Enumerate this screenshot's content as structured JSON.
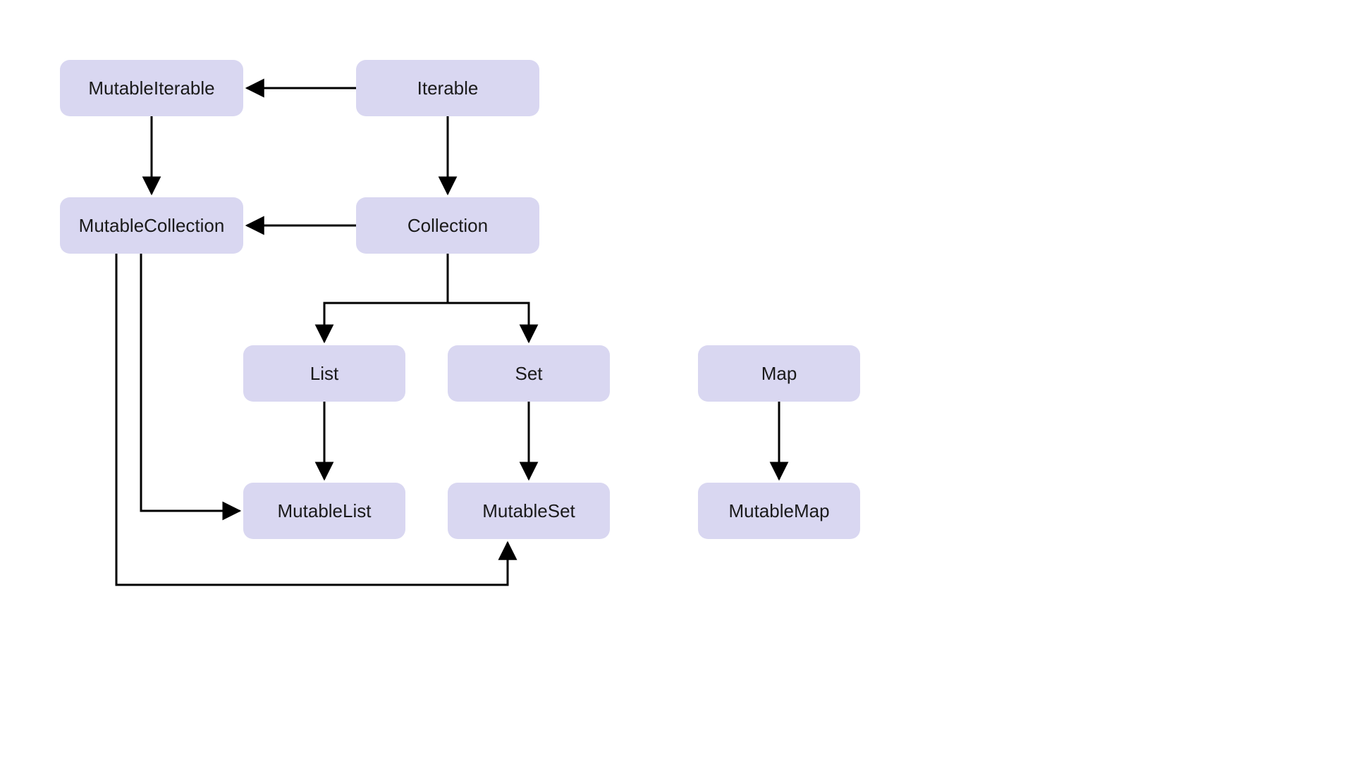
{
  "diagram": {
    "nodes": {
      "mutableIterable": {
        "label": "MutableIterable"
      },
      "iterable": {
        "label": "Iterable"
      },
      "mutableCollection": {
        "label": "MutableCollection"
      },
      "collection": {
        "label": "Collection"
      },
      "list": {
        "label": "List"
      },
      "set": {
        "label": "Set"
      },
      "map": {
        "label": "Map"
      },
      "mutableList": {
        "label": "MutableList"
      },
      "mutableSet": {
        "label": "MutableSet"
      },
      "mutableMap": {
        "label": "MutableMap"
      }
    },
    "edges": [
      {
        "from": "iterable",
        "to": "mutableIterable"
      },
      {
        "from": "iterable",
        "to": "collection"
      },
      {
        "from": "mutableIterable",
        "to": "mutableCollection"
      },
      {
        "from": "collection",
        "to": "mutableCollection"
      },
      {
        "from": "collection",
        "to": "list"
      },
      {
        "from": "collection",
        "to": "set"
      },
      {
        "from": "list",
        "to": "mutableList"
      },
      {
        "from": "set",
        "to": "mutableSet"
      },
      {
        "from": "map",
        "to": "mutableMap"
      },
      {
        "from": "mutableCollection",
        "to": "mutableList"
      },
      {
        "from": "mutableCollection",
        "to": "mutableSet"
      }
    ],
    "colors": {
      "nodeFill": "#d9d7f1",
      "arrow": "#000000"
    }
  }
}
